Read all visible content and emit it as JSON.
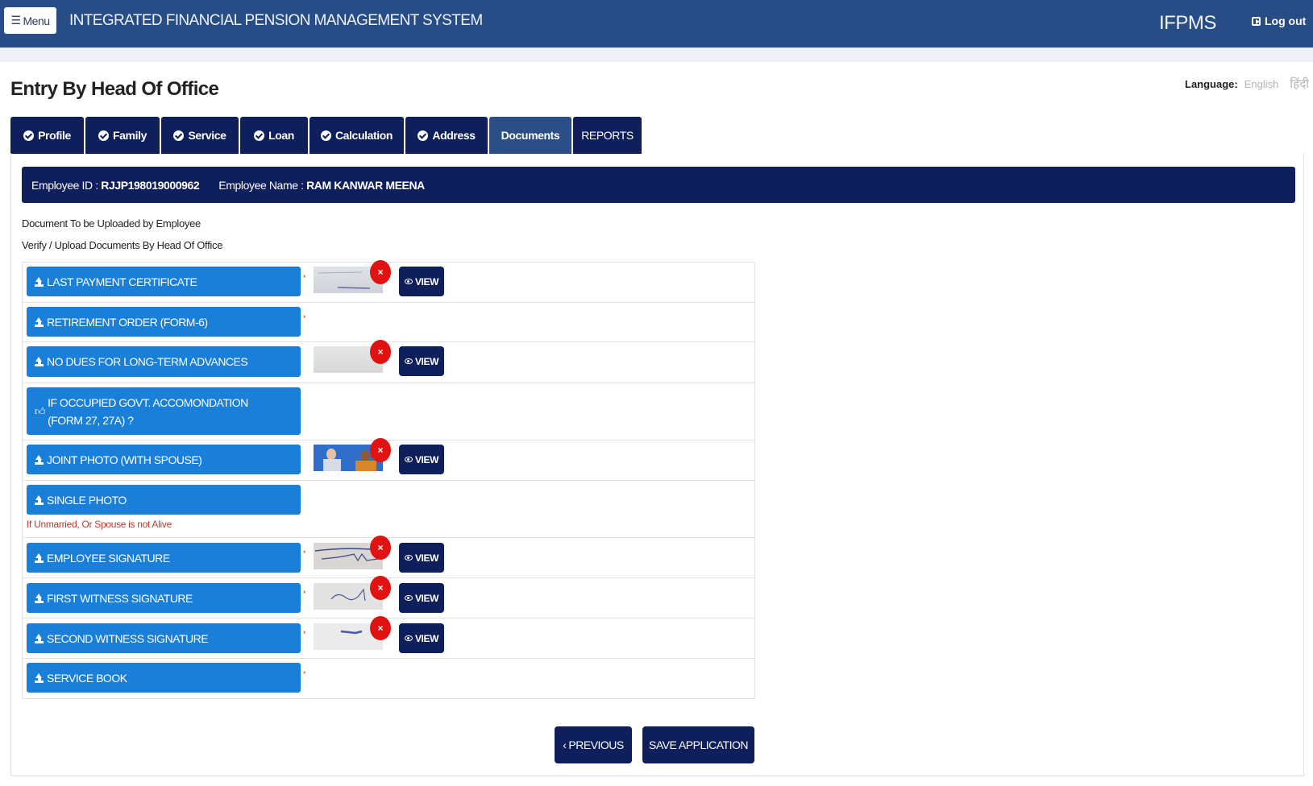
{
  "header": {
    "menu_label": "Menu",
    "app_title": "INTEGRATED FINANCIAL PENSION MANAGEMENT SYSTEM",
    "app_short": "IFPMS",
    "logout_label": "Log out"
  },
  "page": {
    "title": "Entry By Head Of Office",
    "language_label": "Language:",
    "language_options": [
      "English",
      "हिंदी"
    ]
  },
  "tabs": [
    {
      "label": "Profile",
      "checked": true
    },
    {
      "label": "Family",
      "checked": true
    },
    {
      "label": "Service",
      "checked": true
    },
    {
      "label": "Loan",
      "checked": true
    },
    {
      "label": "Calculation",
      "checked": true
    },
    {
      "label": "Address",
      "checked": true
    },
    {
      "label": "Documents",
      "checked": false,
      "active": true
    },
    {
      "label": "REPORTS",
      "checked": false
    }
  ],
  "employee": {
    "id_label": "Employee ID :",
    "id_value": "RJJP198019000962",
    "name_label": "Employee Name :",
    "name_value": "RAM KANWAR MEENA"
  },
  "notes": {
    "employee_docs": "Document To be Uploaded by Employee",
    "hoo_docs": "Verify / Upload Documents By Head Of Office"
  },
  "documents": [
    {
      "label": "LAST PAYMENT CERTIFICATE",
      "required": "*",
      "uploaded": true
    },
    {
      "label": "RETIREMENT ORDER (FORM-6)",
      "required": "*",
      "uploaded": false
    },
    {
      "label": "NO DUES FOR LONG-TERM ADVANCES",
      "required": "",
      "uploaded": true
    },
    {
      "label": "IF OCCUPIED GOVT. ACCOMONDATION (FORM 27, 27A) ?",
      "required": "",
      "uploaded": false
    },
    {
      "label": "JOINT PHOTO (WITH SPOUSE)",
      "required": "",
      "uploaded": true
    },
    {
      "label": "SINGLE PHOTO",
      "required": "",
      "uploaded": false,
      "hint": "If Unmarried, Or Spouse is not Alive"
    },
    {
      "label": "EMPLOYEE SIGNATURE",
      "required": "*",
      "uploaded": true
    },
    {
      "label": "FIRST WITNESS SIGNATURE",
      "required": "*",
      "uploaded": true
    },
    {
      "label": "SECOND WITNESS SIGNATURE",
      "required": "*",
      "uploaded": true
    },
    {
      "label": "SERVICE BOOK",
      "required": "*",
      "uploaded": false
    }
  ],
  "actions": {
    "view_label": "VIEW",
    "delete_symbol": "×",
    "previous_label": "PREVIOUS",
    "save_label": "SAVE APPLICATION"
  },
  "colors": {
    "header_bg": "#274c86",
    "navy": "#0e1f5b",
    "doc_button": "#1a7fd8",
    "delete": "#e31212",
    "hint": "#c0392b"
  }
}
